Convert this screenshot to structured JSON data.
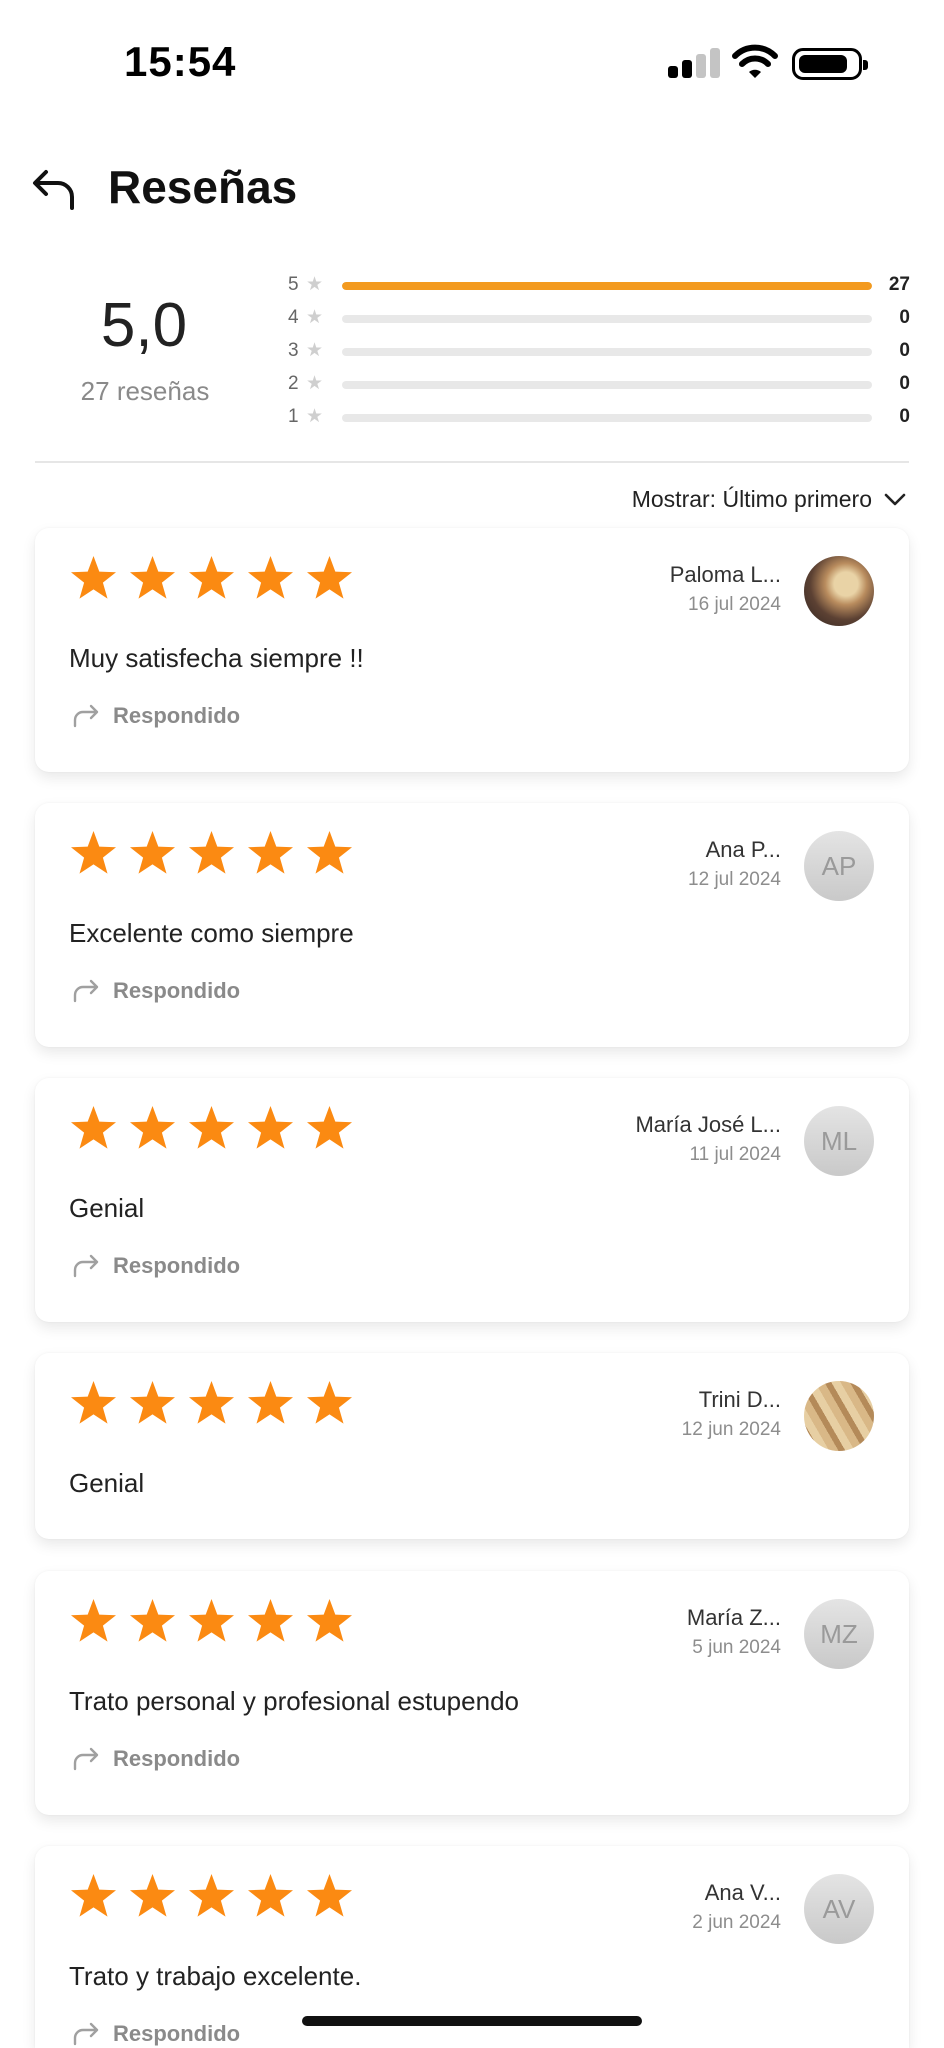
{
  "status": {
    "time": "15:54"
  },
  "header": {
    "title": "Reseñas"
  },
  "summary": {
    "average": "5,0",
    "count_label": "27 reseñas",
    "distribution": [
      {
        "stars": "5",
        "count": "27",
        "fraction": 1.0
      },
      {
        "stars": "4",
        "count": "0",
        "fraction": 0
      },
      {
        "stars": "3",
        "count": "0",
        "fraction": 0
      },
      {
        "stars": "2",
        "count": "0",
        "fraction": 0
      },
      {
        "stars": "1",
        "count": "0",
        "fraction": 0
      }
    ],
    "star_glyph": "★"
  },
  "sort": {
    "label": "Mostrar: Último primero"
  },
  "colors": {
    "accent": "#f39a1f",
    "star": "#fb8a12"
  },
  "reviews": [
    {
      "name": "Paloma L...",
      "date": "16 jul 2024",
      "text": "Muy satisfecha siempre !!",
      "replied": "Respondido",
      "avatar": "",
      "rating": 5
    },
    {
      "name": "Ana P...",
      "date": "12 jul 2024",
      "text": "Excelente como siempre",
      "replied": "Respondido",
      "avatar": "AP",
      "rating": 5
    },
    {
      "name": "María José L...",
      "date": "11 jul 2024",
      "text": "Genial",
      "replied": "Respondido",
      "avatar": "ML",
      "rating": 5
    },
    {
      "name": "Trini D...",
      "date": "12 jun 2024",
      "text": "Genial",
      "replied": "",
      "avatar": "",
      "rating": 5
    },
    {
      "name": "María Z...",
      "date": "5 jun 2024",
      "text": "Trato personal y profesional estupendo",
      "replied": "Respondido",
      "avatar": "MZ",
      "rating": 5
    },
    {
      "name": "Ana V...",
      "date": "2 jun 2024",
      "text": "Trato y trabajo excelente.",
      "replied": "Respondido",
      "avatar": "AV",
      "rating": 5
    }
  ]
}
